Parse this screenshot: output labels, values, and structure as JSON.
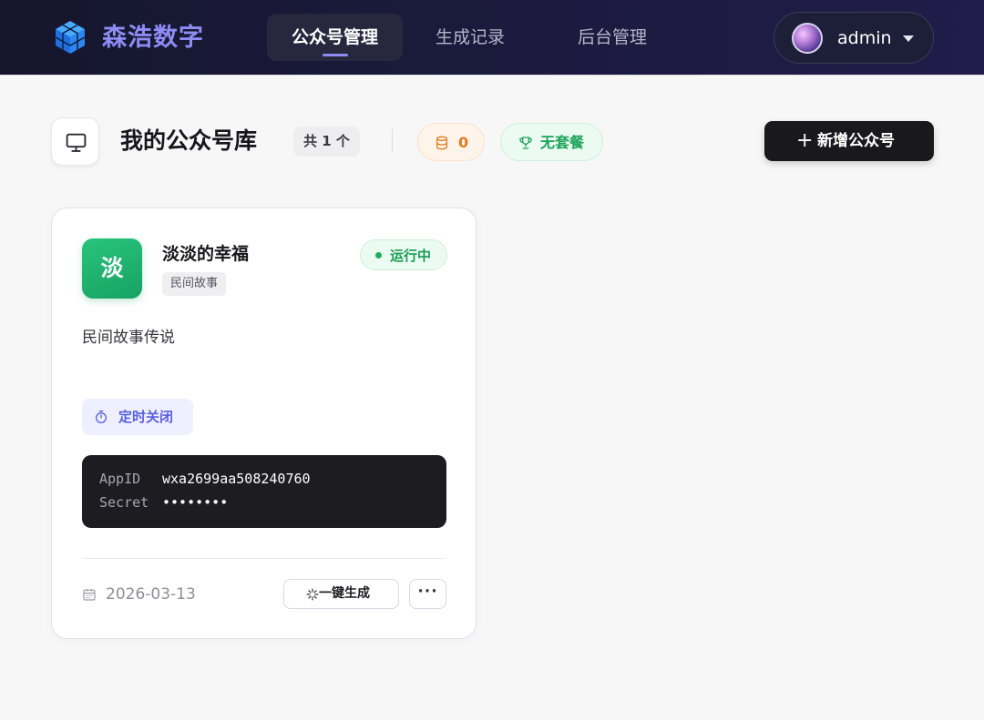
{
  "brand": {
    "name": "森浩数字"
  },
  "nav": {
    "tabs": [
      {
        "label": "公众号管理",
        "active": true
      },
      {
        "label": "生成记录",
        "active": false
      },
      {
        "label": "后台管理",
        "active": false
      }
    ]
  },
  "user": {
    "name": "admin"
  },
  "header": {
    "title": "我的公众号库",
    "count_label": "共 1 个",
    "coins": "0",
    "plan": "无套餐",
    "add_button": "新增公众号"
  },
  "account_card": {
    "avatar_char": "淡",
    "name": "淡淡的幸福",
    "category": "民间故事",
    "status": "运行中",
    "description": "民间故事传说",
    "timer_label": "定时关闭",
    "credentials": {
      "appid_label": "AppID",
      "appid_value": "wxa2699aa508240760",
      "secret_label": "Secret",
      "secret_value": "••••••••"
    },
    "date": "2026-03-13",
    "generate_button": "一键生成",
    "more_button": "···"
  },
  "colors": {
    "brand": "#8e8cf5",
    "topbar": "#1a1a3c",
    "status_green": "#1a9d55",
    "coin_orange": "#e07a1e",
    "accent_indigo": "#5a5fe0"
  },
  "icons": {
    "logo": "cube-logo-icon",
    "monitor": "monitor-icon",
    "coins": "coin-stack-icon",
    "plan": "trophy-icon",
    "timer": "stopwatch-icon",
    "date": "calendar-icon",
    "generate": "sparkle-icon"
  }
}
